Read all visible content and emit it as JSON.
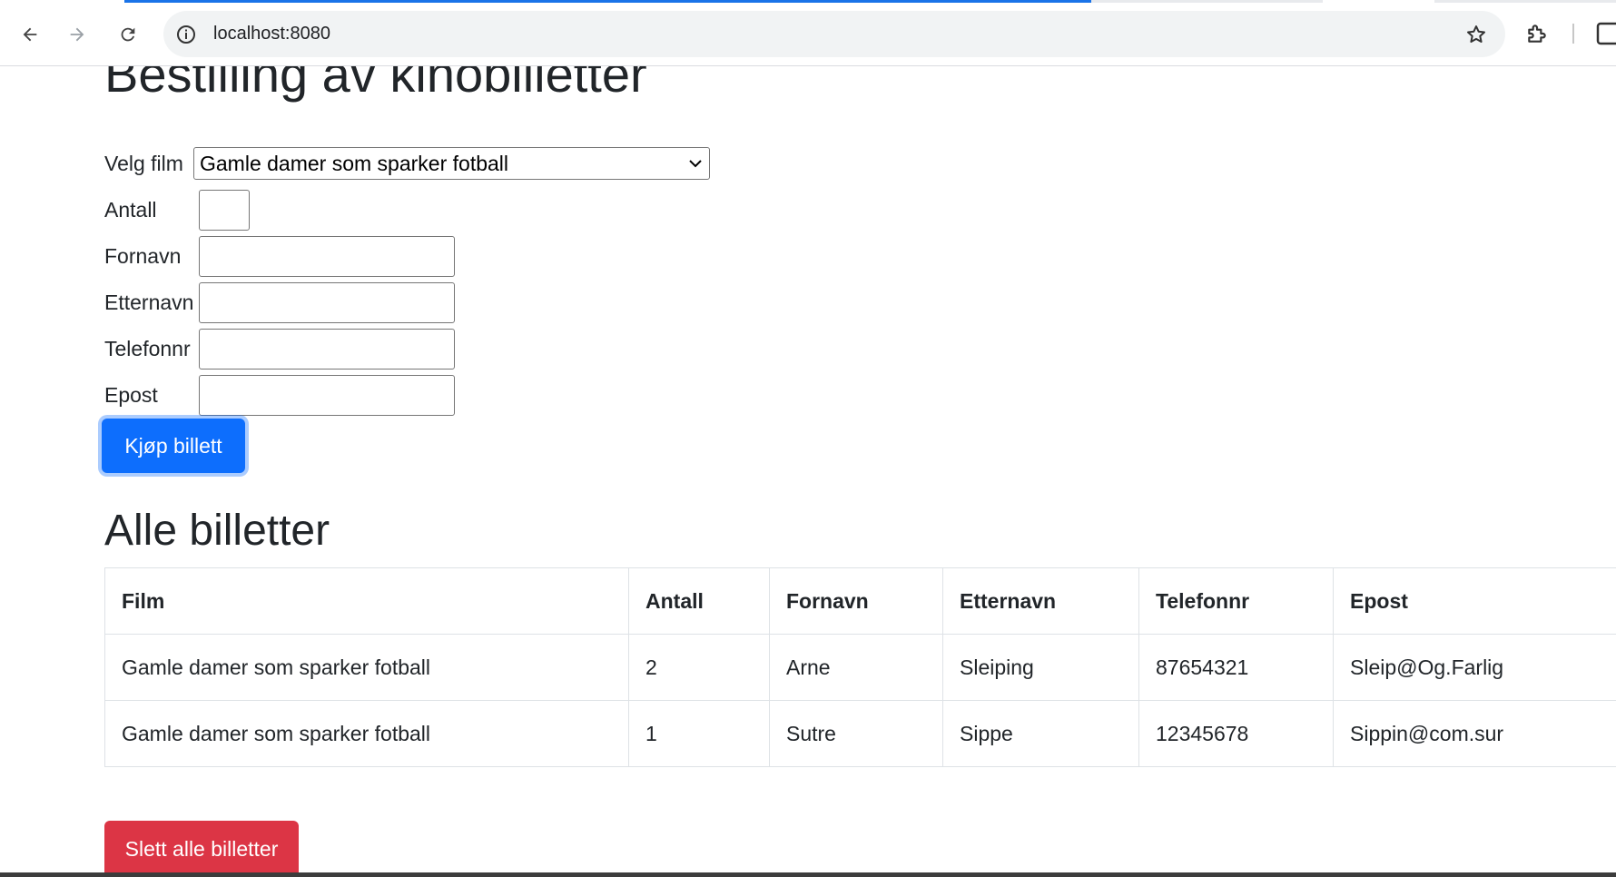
{
  "browser": {
    "url": "localhost:8080"
  },
  "page": {
    "title": "Bestilling av kinobilletter",
    "form": {
      "film_label": "Velg film",
      "film_selected": "Gamle damer som sparker fotball",
      "antall_label": "Antall",
      "fornavn_label": "Fornavn",
      "etternavn_label": "Etternavn",
      "telefonnr_label": "Telefonnr",
      "epost_label": "Epost",
      "submit_label": "Kjøp billett"
    },
    "tickets": {
      "heading": "Alle billetter",
      "columns": [
        "Film",
        "Antall",
        "Fornavn",
        "Etternavn",
        "Telefonnr",
        "Epost"
      ],
      "rows": [
        [
          "Gamle damer som sparker fotball",
          "2",
          "Arne",
          "Sleiping",
          "87654321",
          "Sleip@Og.Farlig"
        ],
        [
          "Gamle damer som sparker fotball",
          "1",
          "Sutre",
          "Sippe",
          "12345678",
          "Sippin@com.sur"
        ]
      ],
      "delete_label": "Slett alle billetter"
    }
  },
  "colors": {
    "primary": "#0d6efd",
    "danger": "#dc3545",
    "browser_accent": "#1a73e8"
  }
}
